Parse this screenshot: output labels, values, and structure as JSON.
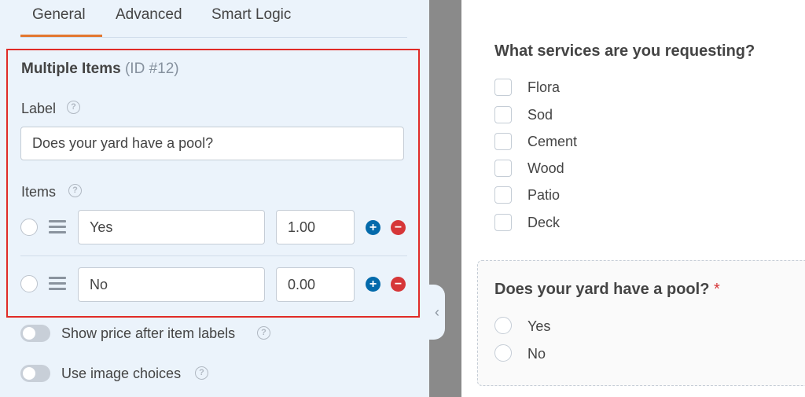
{
  "tabs": [
    {
      "label": "General",
      "active": true
    },
    {
      "label": "Advanced"
    },
    {
      "label": "Smart Logic"
    }
  ],
  "field": {
    "name": "Multiple Items",
    "id_label": "(ID #12)",
    "label_heading": "Label",
    "label_value": "Does your yard have a pool?",
    "items_heading": "Items",
    "items": [
      {
        "label": "Yes",
        "price": "1.00"
      },
      {
        "label": "No",
        "price": "0.00"
      }
    ]
  },
  "toggles": [
    {
      "label": "Show price after item labels",
      "on": false
    },
    {
      "label": "Use image choices",
      "on": false
    }
  ],
  "preview": {
    "question1": "What services are you requesting?",
    "options1": [
      "Flora",
      "Sod",
      "Cement",
      "Wood",
      "Patio",
      "Deck"
    ],
    "question2": "Does your yard have a pool?",
    "required_mark": "*",
    "options2": [
      "Yes",
      "No"
    ]
  },
  "colors": {
    "panel_bg": "#ebf3fb",
    "tab_accent": "#e27730",
    "highlight_border": "#e02b27",
    "plus_button": "#036aab",
    "minus_button": "#d63638"
  },
  "icons": {
    "help": "question-circle-icon",
    "drag": "drag-handle-icon",
    "add": "plus-circle-icon",
    "remove": "minus-circle-icon",
    "collapse": "chevron-left-icon"
  }
}
